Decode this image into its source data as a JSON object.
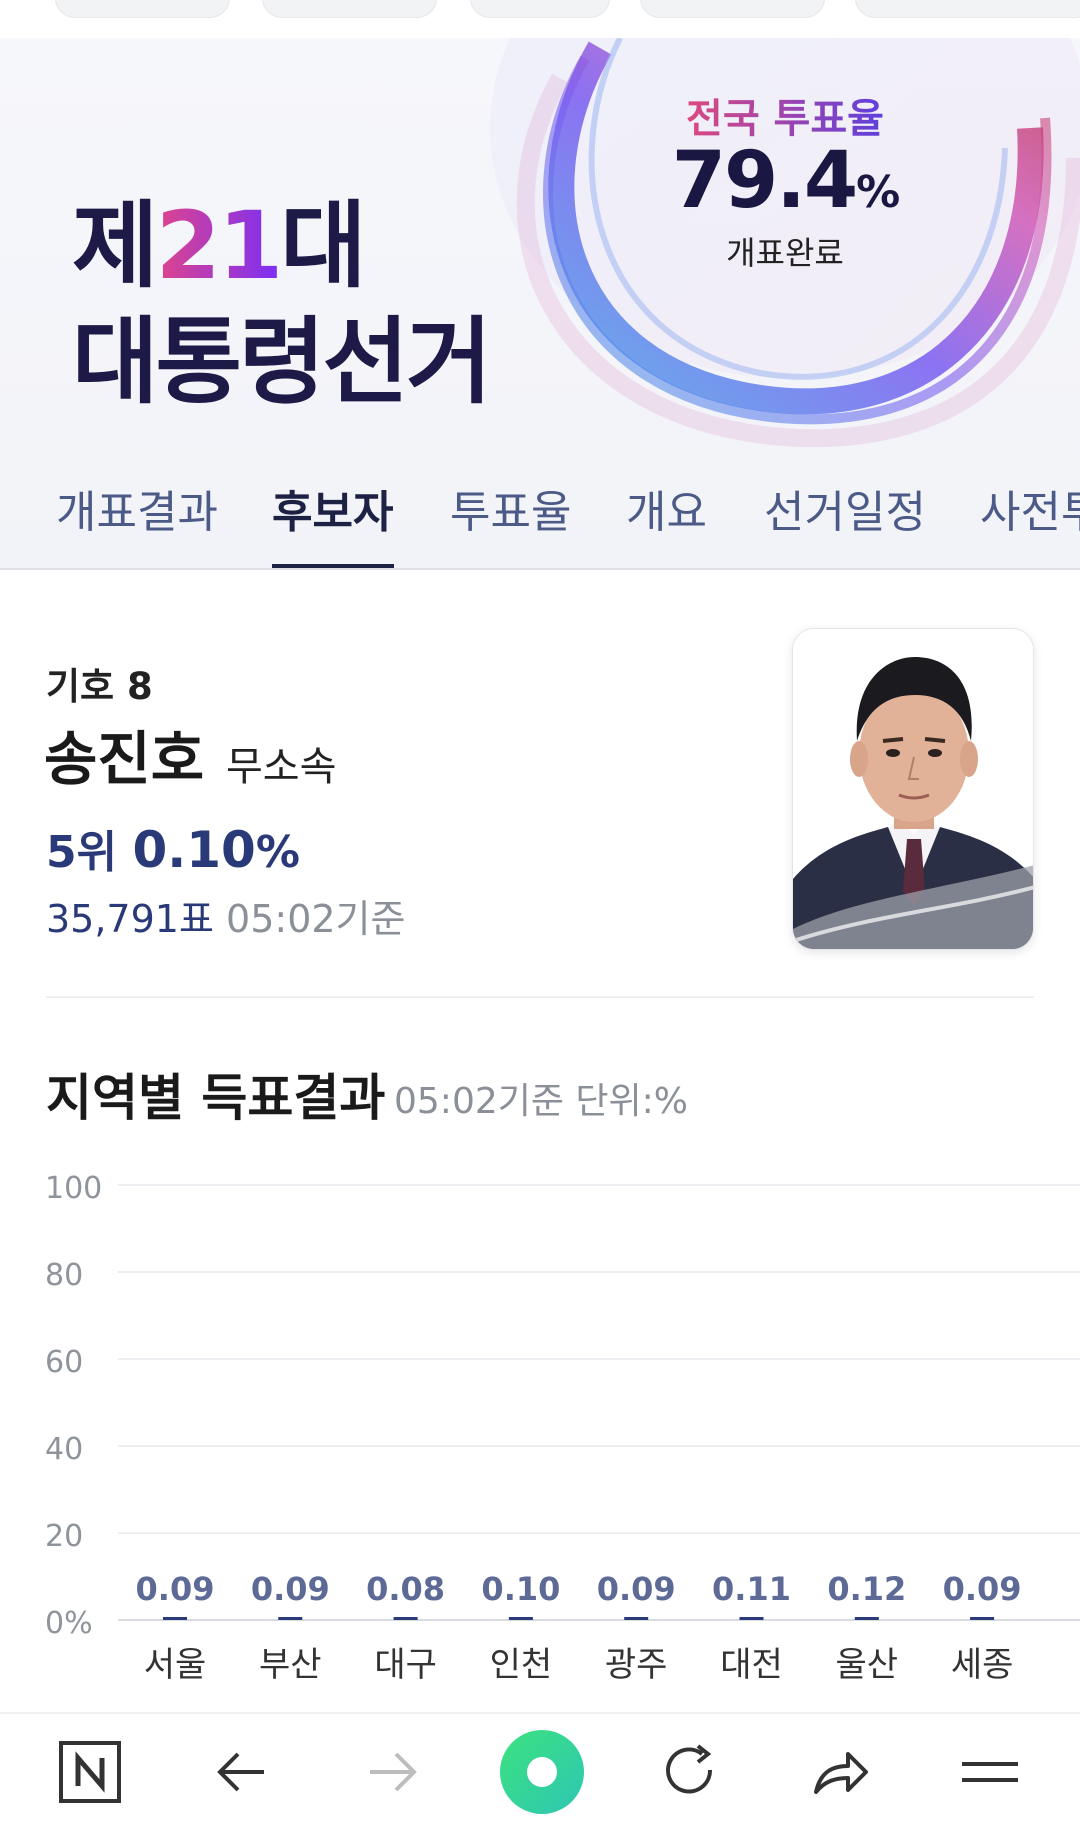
{
  "banner": {
    "title_prefix": "제",
    "title_number": "21",
    "title_suffix": "대",
    "title_line2": "대통령선거",
    "turnout_label": "전국 투표율",
    "turnout_value": "79.4",
    "turnout_unit": "%",
    "turnout_status": "개표완료"
  },
  "tabs": [
    {
      "label": "개표결과",
      "active": false
    },
    {
      "label": "후보자",
      "active": true
    },
    {
      "label": "투표율",
      "active": false
    },
    {
      "label": "개요",
      "active": false
    },
    {
      "label": "선거일정",
      "active": false
    },
    {
      "label": "사전투",
      "active": false
    }
  ],
  "candidate": {
    "number_label": "기호 8",
    "name": "송진호",
    "party": "무소속",
    "rank": "5위",
    "share": "0.10",
    "share_unit": "%",
    "votes": "35,791표",
    "as_of": "05:02기준"
  },
  "regional": {
    "title": "지역별 득표결과",
    "meta": "05:02기준 단위:%"
  },
  "chart_data": {
    "type": "bar",
    "categories": [
      "서울",
      "부산",
      "대구",
      "인천",
      "광주",
      "대전",
      "울산",
      "세종"
    ],
    "values": [
      0.09,
      0.09,
      0.08,
      0.1,
      0.09,
      0.11,
      0.12,
      0.09
    ],
    "value_labels": [
      "0.09",
      "0.09",
      "0.08",
      "0.10",
      "0.09",
      "0.11",
      "0.12",
      "0.09"
    ],
    "yticks": [
      "100",
      "80",
      "60",
      "40",
      "20",
      "0%"
    ],
    "ylim": [
      0,
      100
    ],
    "grid": true,
    "bar_color": "#2b3a7a"
  },
  "colors": {
    "navy": "#1d1a47",
    "accent_blue": "#2a3a78",
    "tab_inactive": "#4b5a86"
  },
  "bottom_nav": [
    "n-icon",
    "back-arrow-icon",
    "forward-arrow-icon",
    "home-circle-icon",
    "reload-icon",
    "share-icon",
    "menu-icon"
  ]
}
